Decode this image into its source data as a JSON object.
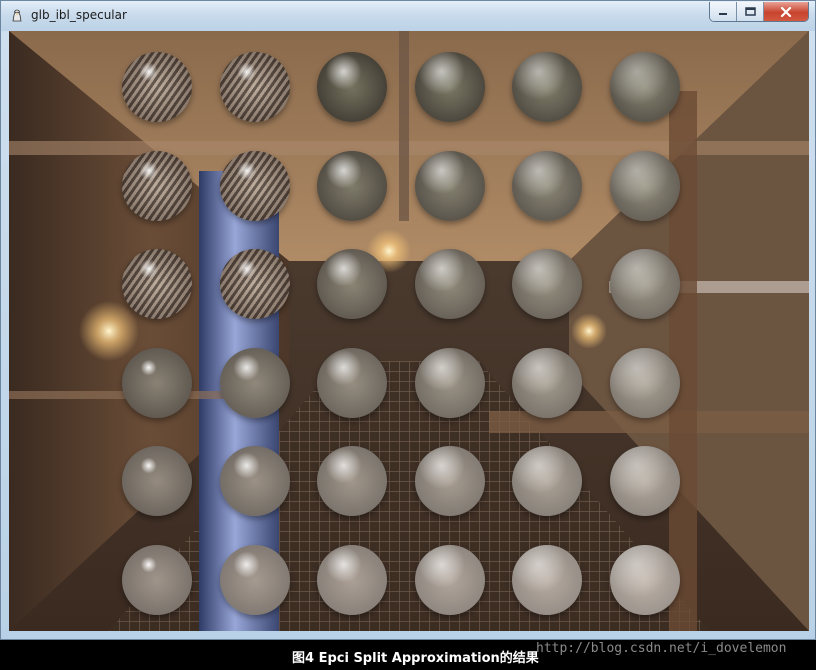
{
  "window": {
    "title": "glb_ibl_specular",
    "controls": {
      "minimize": "minimize",
      "maximize": "maximize",
      "close": "close"
    }
  },
  "scene": {
    "rows": 6,
    "columns": 6,
    "environment": "industrial interior with pipes and metal grating floor"
  },
  "caption": "图4 Epci Split Approximation的结果",
  "watermark": "http://blog.csdn.net/i_dovelemon",
  "colors": {
    "title_bar": "#c9dbec",
    "close_button": "#c8442f",
    "caption_bg": "#000000",
    "caption_text": "#ffffff"
  }
}
